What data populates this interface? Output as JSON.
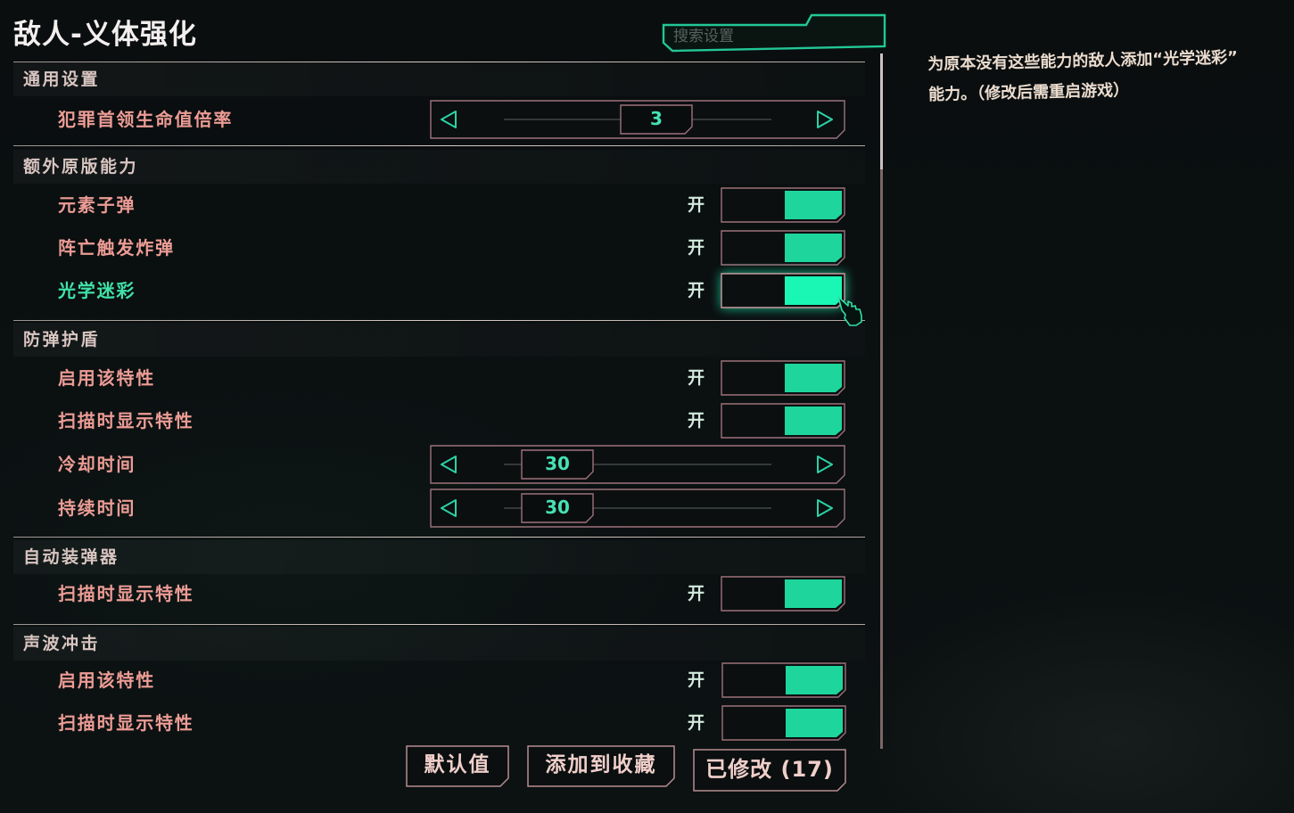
{
  "title": "敌人-义体强化",
  "search": {
    "placeholder": "搜索设置"
  },
  "sections": [
    {
      "header": "通用设置",
      "items": [
        {
          "label": "犯罪首领生命值倍率",
          "value": "3",
          "level": 0.57
        }
      ]
    },
    {
      "header": "额外原版能力",
      "items": [
        {
          "label": "元素子弹",
          "state_label": "开",
          "on": true
        },
        {
          "label": "阵亡触发炸弹",
          "state_label": "开",
          "on": true
        },
        {
          "label": "光学迷彩",
          "state_label": "开",
          "on": true,
          "hovered": true
        }
      ]
    },
    {
      "header": "防弹护盾",
      "items": [
        {
          "label": "启用该特性",
          "state_label": "开",
          "on": true
        },
        {
          "label": "扫描时显示特性",
          "state_label": "开",
          "on": true
        },
        {
          "label": "冷却时间",
          "value": "30",
          "level": 0.2
        },
        {
          "label": "持续时间",
          "value": "30",
          "level": 0.2
        }
      ]
    },
    {
      "header": "自动装弹器",
      "items": [
        {
          "label": "扫描时显示特性",
          "state_label": "开",
          "on": true
        }
      ]
    },
    {
      "header": "声波冲击",
      "items": [
        {
          "label": "启用该特性",
          "state_label": "开",
          "on": true
        },
        {
          "label": "扫描时显示特性",
          "state_label": "开",
          "on": true
        }
      ]
    }
  ],
  "description": {
    "lines": [
      "为原本没有这些能力的敌人添加“光学迷彩”",
      "能力。（修改后需重启游戏）"
    ]
  },
  "buttons": {
    "defaults": "默认值",
    "add_favorite": "添加到收藏",
    "modified": "已修改 (17)"
  },
  "icons": {
    "arrow_left": "arrow-left-icon",
    "arrow_right": "arrow-right-icon",
    "cursor": "cursor-hand-icon"
  },
  "colors": {
    "background": "#090d0e",
    "title": "#f3efee",
    "header": "#d8c5c1",
    "label": "#ec9c95",
    "label_hover": "#3fe3a8",
    "accent": "#1ed69c",
    "accent_hover": "#1af7b5",
    "frame": "#9c727a",
    "separator": "#d9cbc6",
    "arrow": "#2bd2a5",
    "value_text": "#46e1b4",
    "state_text": "#d3e9de",
    "description": "#ebdcce",
    "button_text": "#f0cfca",
    "button_frame": "#b78d8f",
    "search_frame": "#22c795",
    "placeholder": "#56625e",
    "scrollbar": "#8f7676",
    "scrollbar_thumb": "#ece1df"
  }
}
